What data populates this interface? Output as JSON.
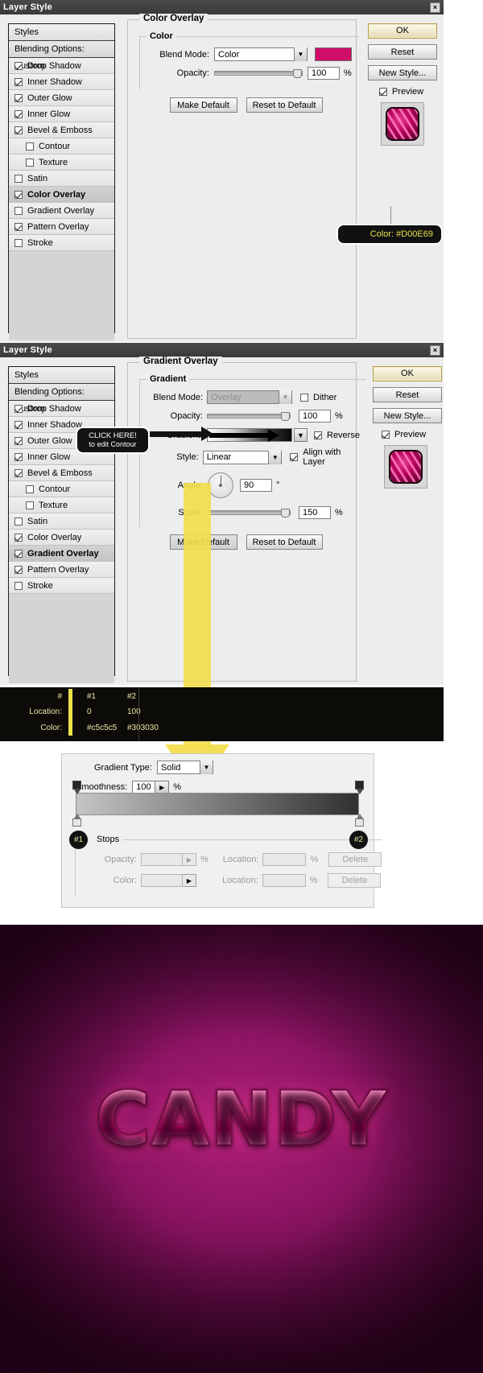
{
  "dialog1": {
    "title": "Layer Style",
    "close_label": "×",
    "styles": {
      "header": "Styles",
      "blending": "Blending Options: Custom",
      "items": [
        {
          "label": "Drop Shadow",
          "checked": true,
          "indent": false,
          "selected": false
        },
        {
          "label": "Inner Shadow",
          "checked": true,
          "indent": false,
          "selected": false
        },
        {
          "label": "Outer Glow",
          "checked": true,
          "indent": false,
          "selected": false
        },
        {
          "label": "Inner Glow",
          "checked": true,
          "indent": false,
          "selected": false
        },
        {
          "label": "Bevel & Emboss",
          "checked": true,
          "indent": false,
          "selected": false
        },
        {
          "label": "Contour",
          "checked": false,
          "indent": true,
          "selected": false
        },
        {
          "label": "Texture",
          "checked": false,
          "indent": true,
          "selected": false
        },
        {
          "label": "Satin",
          "checked": false,
          "indent": false,
          "selected": false
        },
        {
          "label": "Color Overlay",
          "checked": true,
          "indent": false,
          "selected": true
        },
        {
          "label": "Gradient Overlay",
          "checked": false,
          "indent": false,
          "selected": false
        },
        {
          "label": "Pattern Overlay",
          "checked": true,
          "indent": false,
          "selected": false
        },
        {
          "label": "Stroke",
          "checked": false,
          "indent": false,
          "selected": false
        }
      ]
    },
    "panel": {
      "section_title": "Color Overlay",
      "group_title": "Color",
      "blend_mode_label": "Blend Mode:",
      "blend_mode_value": "Color",
      "color_swatch": "#D00E69",
      "opacity_label": "Opacity:",
      "opacity_value": "100",
      "opacity_unit": "%",
      "make_default": "Make Default",
      "reset_to_default": "Reset to Default"
    },
    "buttons": {
      "ok": "OK",
      "reset": "Reset",
      "new_style": "New Style...",
      "preview": "Preview",
      "preview_checked": true
    },
    "tooltip": {
      "text": "Color: #D00E69",
      "text_color": "#e9e34f",
      "bg_color": "#111111"
    }
  },
  "dialog2": {
    "title": "Layer Style",
    "close_label": "×",
    "styles": {
      "header": "Styles",
      "blending": "Blending Options: Custom",
      "items": [
        {
          "label": "Drop Shadow",
          "checked": true,
          "indent": false,
          "selected": false
        },
        {
          "label": "Inner Shadow",
          "checked": true,
          "indent": false,
          "selected": false
        },
        {
          "label": "Outer Glow",
          "checked": true,
          "indent": false,
          "selected": false
        },
        {
          "label": "Inner Glow",
          "checked": true,
          "indent": false,
          "selected": false
        },
        {
          "label": "Bevel & Emboss",
          "checked": true,
          "indent": false,
          "selected": false
        },
        {
          "label": "Contour",
          "checked": false,
          "indent": true,
          "selected": false
        },
        {
          "label": "Texture",
          "checked": false,
          "indent": true,
          "selected": false
        },
        {
          "label": "Satin",
          "checked": false,
          "indent": false,
          "selected": false
        },
        {
          "label": "Color Overlay",
          "checked": true,
          "indent": false,
          "selected": false
        },
        {
          "label": "Gradient Overlay",
          "checked": true,
          "indent": false,
          "selected": true
        },
        {
          "label": "Pattern Overlay",
          "checked": true,
          "indent": false,
          "selected": false
        },
        {
          "label": "Stroke",
          "checked": false,
          "indent": false,
          "selected": false
        }
      ]
    },
    "panel": {
      "section_title": "Gradient Overlay",
      "group_title": "Gradient",
      "blend_mode_label": "Blend Mode:",
      "blend_mode_value": "Overlay",
      "dither_label": "Dither",
      "dither_checked": false,
      "opacity_label": "Opacity:",
      "opacity_value": "100",
      "opacity_unit": "%",
      "gradient_label": "Gradient:",
      "reverse_label": "Reverse",
      "reverse_checked": true,
      "style_label": "Style:",
      "style_value": "Linear",
      "align_label": "Align with Layer",
      "align_checked": true,
      "angle_label": "Angle:",
      "angle_value": "90",
      "angle_unit": "°",
      "scale_label": "Scale:",
      "scale_value": "150",
      "scale_unit": "%",
      "make_default": "Make Default",
      "reset_to_default": "Reset to Default"
    },
    "buttons": {
      "ok": "OK",
      "reset": "Reset",
      "new_style": "New Style...",
      "preview": "Preview",
      "preview_checked": true
    },
    "tooltip": {
      "line1": "CLICK HERE!",
      "line2": "to edit Contour"
    }
  },
  "data_strip": {
    "rows": [
      {
        "label": "#",
        "c1": "#1",
        "c2": "#2"
      },
      {
        "label": "Location:",
        "c1": "0",
        "c2": "100"
      },
      {
        "label": "Color:",
        "c1": "#c5c5c5",
        "c2": "#303030"
      }
    ]
  },
  "gradient_editor": {
    "gradient_type_label": "Gradient Type:",
    "gradient_type_value": "Solid",
    "smoothness_label": "Smoothness:",
    "smoothness_value": "100",
    "smoothness_unit": "%",
    "stops_title": "Stops",
    "opacity_label": "Opacity:",
    "opacity_value": "",
    "opacity_unit": "%",
    "color_label": "Color:",
    "location_label_1": "Location:",
    "location_value_1": "",
    "location_unit_1": "%",
    "location_label_2": "Location:",
    "location_value_2": "",
    "location_unit_2": "%",
    "delete_1": "Delete",
    "delete_2": "Delete",
    "badge_left": "#1",
    "badge_right": "#2",
    "ramp_start_color": "#c5c5c5",
    "ramp_end_color": "#303030"
  },
  "artwork": {
    "text": "CANDY",
    "background_color": "#8e1464",
    "text_color": "#ff4fa4"
  }
}
